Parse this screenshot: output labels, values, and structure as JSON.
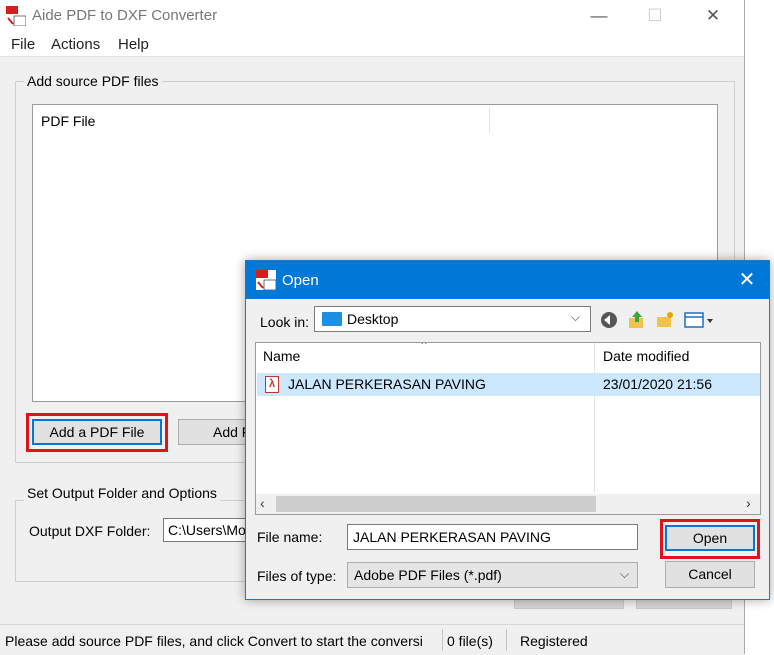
{
  "app": {
    "title": "Aide PDF to DXF Converter",
    "icon_text": "PDF",
    "icon_sub": "DXF",
    "minimize": "—",
    "maximize": "☐",
    "close": "✕"
  },
  "menu": {
    "items": [
      "File",
      "Actions",
      "Help"
    ]
  },
  "source": {
    "group_label": "Add source PDF files",
    "list_column": "PDF File",
    "add_file_button": "Add a PDF File",
    "add_folder_button": "Add F"
  },
  "output": {
    "group_label": "Set Output Folder and Options",
    "folder_label": "Output DXF Folder:",
    "folder_value": "C:\\Users\\Mo"
  },
  "status": {
    "message": "Please add source PDF files, and click Convert to start the conversi",
    "file_count": "0 file(s)",
    "registration": "Registered"
  },
  "dialog": {
    "title": "Open",
    "close": "✕",
    "look_in_label": "Look in:",
    "look_in_value": "Desktop",
    "columns": {
      "name": "Name",
      "date": "Date modified"
    },
    "files": [
      {
        "name": "JALAN PERKERASAN PAVING",
        "date": "23/01/2020 21:56"
      }
    ],
    "file_name_label": "File name:",
    "file_name_value": "JALAN PERKERASAN PAVING",
    "file_type_label": "Files of type:",
    "file_type_value": "Adobe PDF Files (*.pdf)",
    "open_button": "Open",
    "cancel_button": "Cancel"
  },
  "colors": {
    "highlight": "#e0131a",
    "accent": "#0078d7",
    "selection": "#cce8ff"
  }
}
